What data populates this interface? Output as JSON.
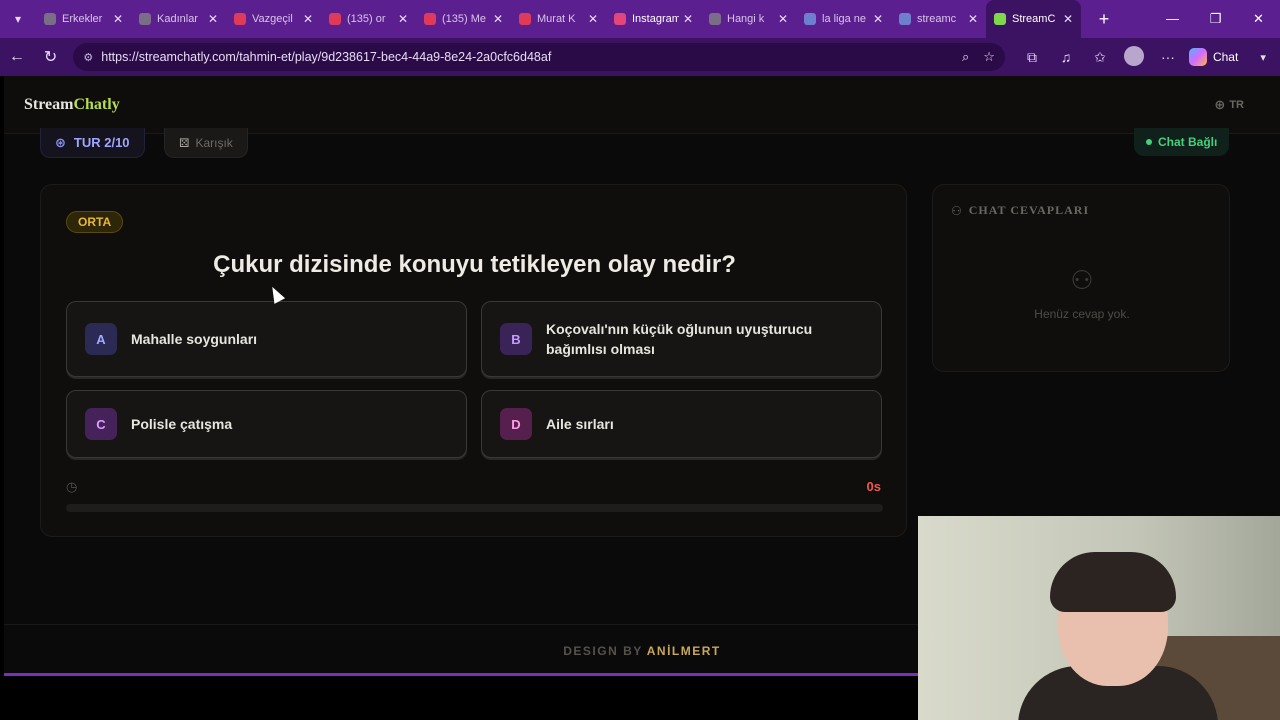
{
  "browser": {
    "tabs": [
      {
        "label": "Erkekler",
        "color": "#7a6d86"
      },
      {
        "label": "Kadınlar",
        "color": "#7a6d86"
      },
      {
        "label": "Vazgeçil",
        "color": "#e03a5a"
      },
      {
        "label": "(135) or",
        "color": "#e03a5a"
      },
      {
        "label": "(135) Me",
        "color": "#e03a5a"
      },
      {
        "label": "Murat K",
        "color": "#e03a5a"
      },
      {
        "label": "Instagram",
        "color": "#e4457a"
      },
      {
        "label": "Hangi k",
        "color": "#7a6d86"
      },
      {
        "label": "la liga ne",
        "color": "#6f7fd0"
      },
      {
        "label": "streamc",
        "color": "#6f7fd0"
      },
      {
        "label": "StreamC",
        "color": "#7fd84a",
        "active": true
      }
    ],
    "url": "https://streamchatly.com/tahmin-et/play/9d238617-bec4-44a9-8e24-2a0cfc6d48af",
    "chat_label": "Chat"
  },
  "site": {
    "logo_main": "Stream",
    "logo_accent": "Chatly",
    "language": "TR"
  },
  "game": {
    "round_label": "TUR 2/10",
    "mode_label": "Karışık",
    "connection_status": "Chat Bağlı",
    "difficulty": "ORTA",
    "question": "Çukur dizisinde konuyu tetikleyen olay nedir?",
    "options": [
      {
        "letter": "A",
        "text": "Mahalle soygunları"
      },
      {
        "letter": "B",
        "text": "Koçovalı'nın küçük oğlunun uyuşturucu bağımlısı olması"
      },
      {
        "letter": "C",
        "text": "Polisle çatışma"
      },
      {
        "letter": "D",
        "text": "Aile sırları"
      }
    ],
    "timer_value": "0s",
    "timer_progress": 0
  },
  "chat_panel": {
    "title": "CHAT CEVAPLARI",
    "empty_text": "Henüz cevap yok."
  },
  "footer": {
    "prefix": "DESIGN BY",
    "name": "ANİLMERT"
  },
  "colors": {
    "accent_purple": "#5b1f8f",
    "logo_accent": "#b7dd4f",
    "difficulty_gold": "#e6b83a",
    "timer_red": "#f0584e",
    "connected_green": "#46d07b"
  }
}
